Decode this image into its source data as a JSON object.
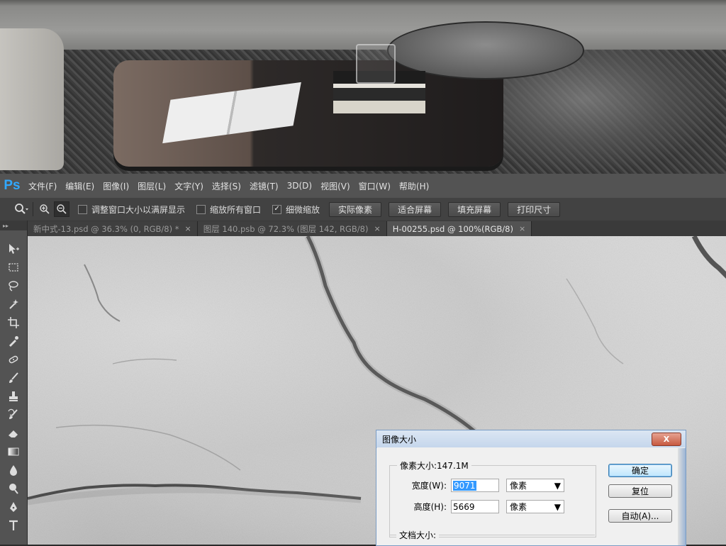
{
  "app": {
    "logo": "Ps"
  },
  "menu": [
    "文件(F)",
    "编辑(E)",
    "图像(I)",
    "图层(L)",
    "文字(Y)",
    "选择(S)",
    "滤镜(T)",
    "3D(D)",
    "视图(V)",
    "窗口(W)",
    "帮助(H)"
  ],
  "options": {
    "checks": [
      {
        "label": "调整窗口大小以满屏显示",
        "checked": false
      },
      {
        "label": "缩放所有窗口",
        "checked": false
      },
      {
        "label": "细微缩放",
        "checked": true
      }
    ],
    "buttons": [
      "实际像素",
      "适合屏幕",
      "填充屏幕",
      "打印尺寸"
    ]
  },
  "tabs": [
    {
      "title": "新中式-13.psd @ 36.3% (0, RGB/8) *",
      "close": "×"
    },
    {
      "title": "图层 140.psb @ 72.3% (图层 142, RGB/8)",
      "close": "×"
    },
    {
      "title": "H-00255.psd @ 100%(RGB/8)",
      "close": "×"
    }
  ],
  "toolbox": {
    "grip": "▸▸"
  },
  "dialog": {
    "title": "图像大小",
    "close": "X",
    "pixel_legend": "像素大小:147.1M",
    "width_label": "宽度(W):",
    "width_value": "9071",
    "height_label": "高度(H):",
    "height_value": "5669",
    "unit": "像素",
    "doc_legend": "文档大小:",
    "ok": "确定",
    "reset": "复位",
    "auto": "自动(A)..."
  }
}
